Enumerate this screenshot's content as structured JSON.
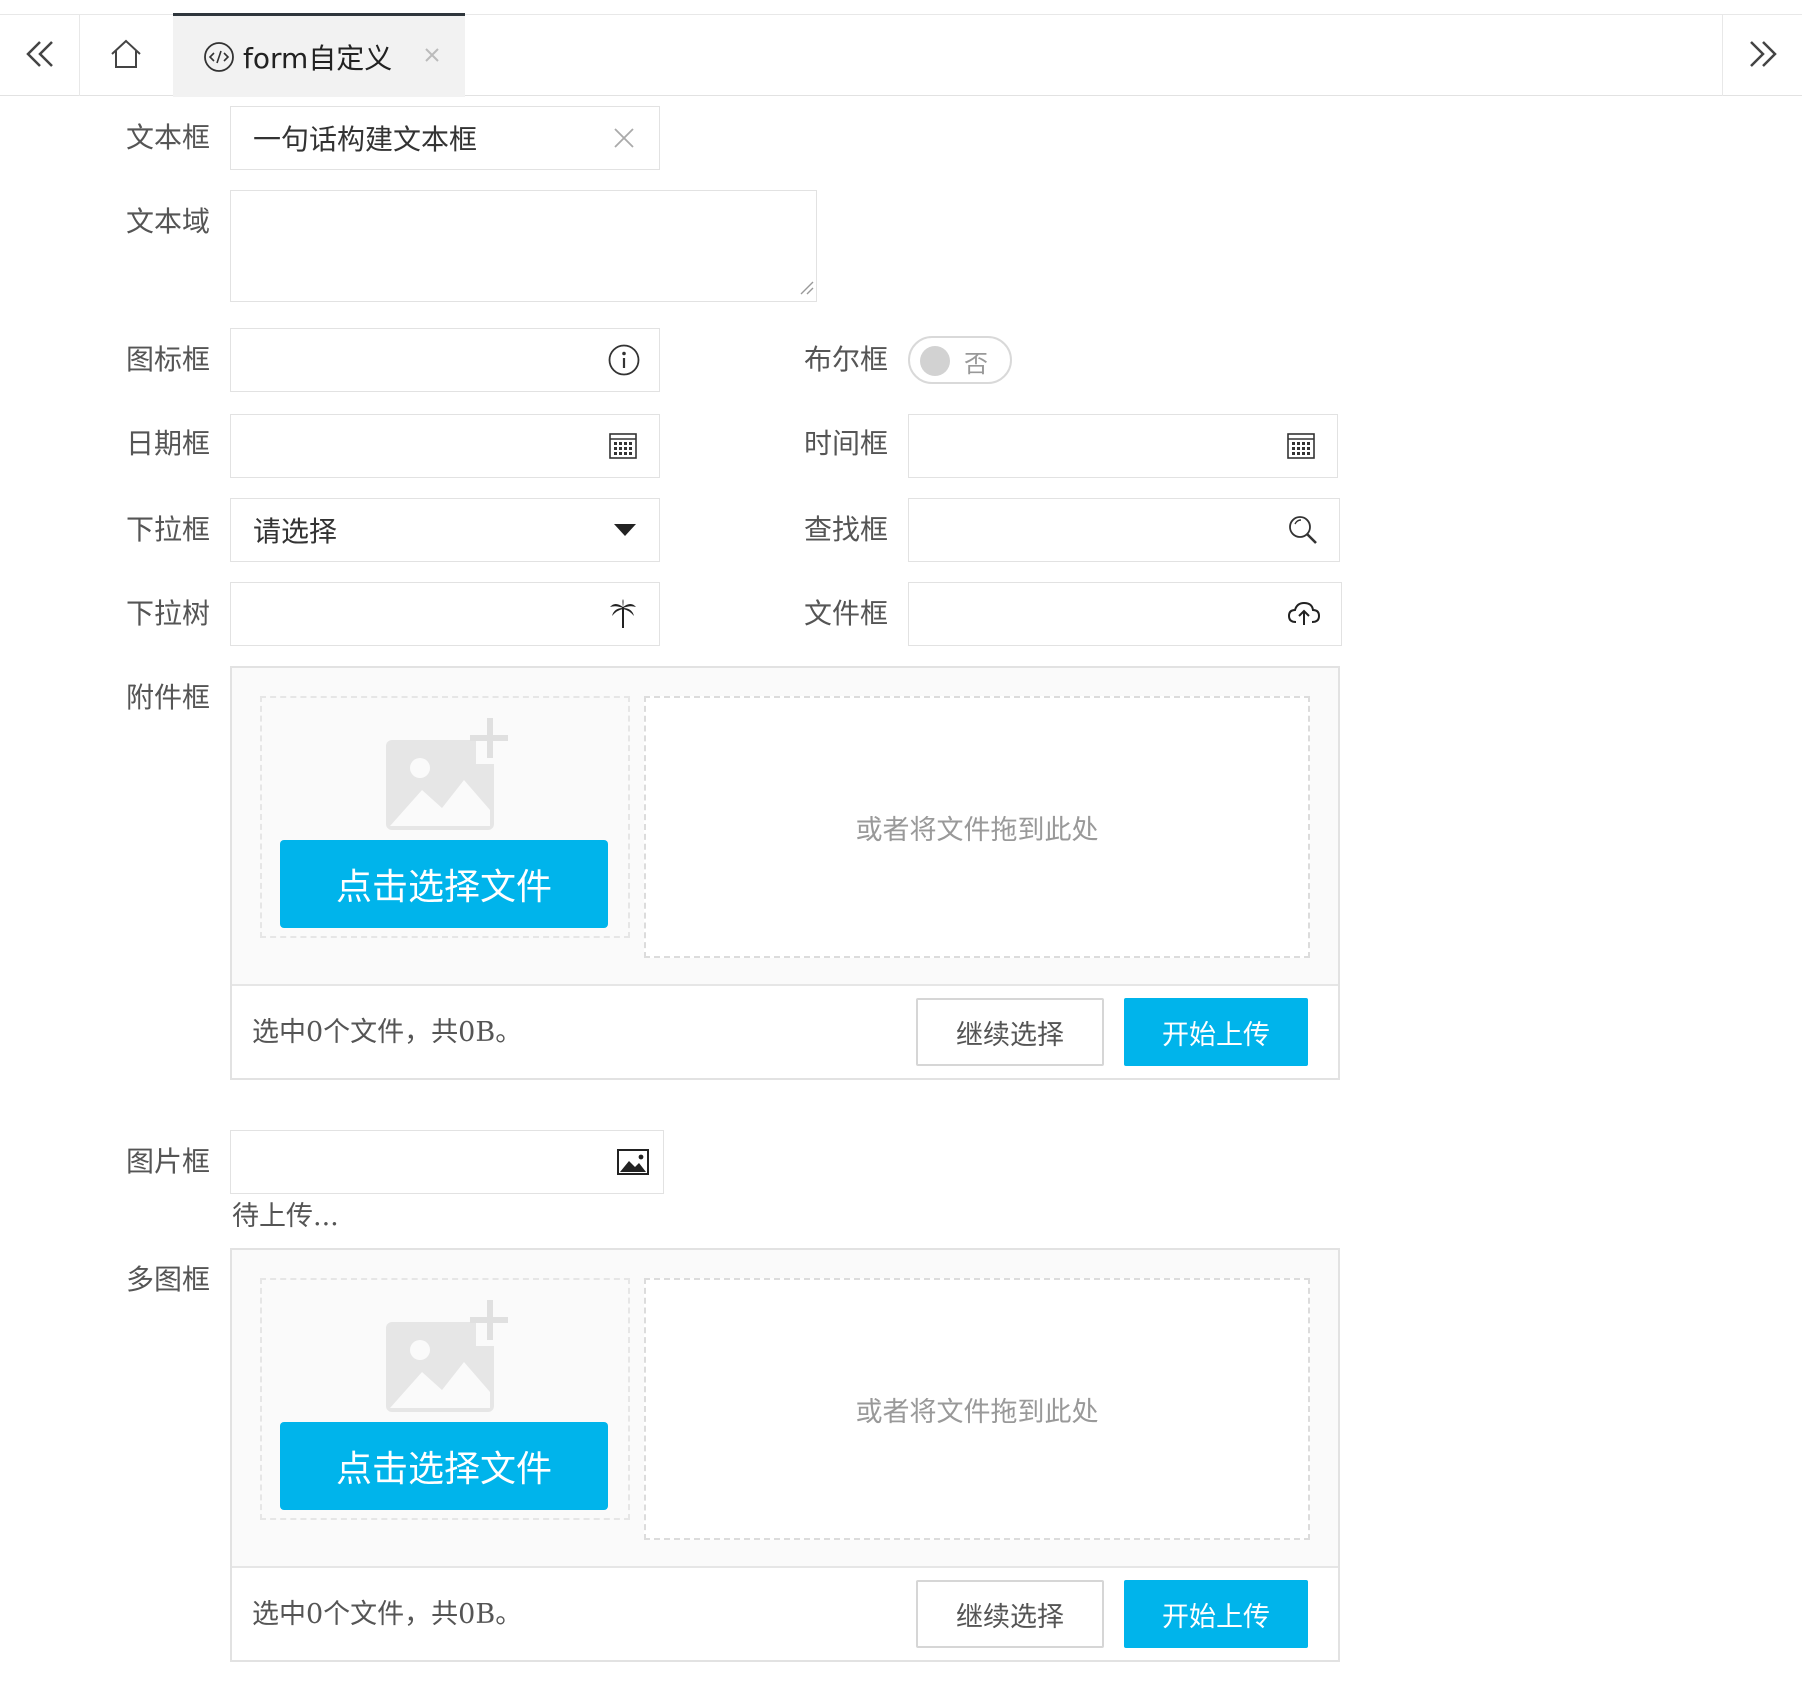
{
  "tabs": {
    "active_tab_title": "form自定义",
    "icons": {
      "prev": "double-chevron-left-icon",
      "home": "home-icon",
      "code": "code-icon",
      "close": "close-icon",
      "next": "double-chevron-right-icon"
    }
  },
  "form": {
    "text_field": {
      "label": "文本框",
      "value": "一句话构建文本框"
    },
    "textarea": {
      "label": "文本域",
      "value": ""
    },
    "icon_field": {
      "label": "图标框",
      "value": "",
      "icon": "info-icon"
    },
    "bool_field": {
      "label": "布尔框",
      "switch_text": "否",
      "checked": false
    },
    "date_field": {
      "label": "日期框",
      "value": "",
      "icon": "calendar-icon"
    },
    "time_field": {
      "label": "时间框",
      "value": "",
      "icon": "calendar-icon"
    },
    "select_field": {
      "label": "下拉框",
      "placeholder": "请选择",
      "icon": "caret-down-icon"
    },
    "search_field": {
      "label": "查找框",
      "value": "",
      "icon": "search-icon"
    },
    "tree_select_field": {
      "label": "下拉树",
      "value": "",
      "icon": "palm-tree-icon"
    },
    "file_field": {
      "label": "文件框",
      "value": "",
      "icon": "cloud-upload-icon"
    },
    "attachment_field": {
      "label": "附件框",
      "pick_button": "点击选择文件",
      "drop_hint": "或者将文件拖到此处",
      "status": "选中0个文件，共0B。",
      "continue_button": "继续选择",
      "start_button": "开始上传"
    },
    "image_field": {
      "label": "图片框",
      "value": "",
      "icon": "image-icon",
      "status": "待上传..."
    },
    "multi_image_field": {
      "label": "多图框",
      "pick_button": "点击选择文件",
      "drop_hint": "或者将文件拖到此处",
      "status": "选中0个文件，共0B。",
      "continue_button": "继续选择",
      "start_button": "开始上传"
    }
  },
  "colors": {
    "accent": "#00b4eb",
    "border": "#e2e2e2",
    "active_tab_bg": "#f2f2f2",
    "active_tab_top": "#2f363c"
  }
}
